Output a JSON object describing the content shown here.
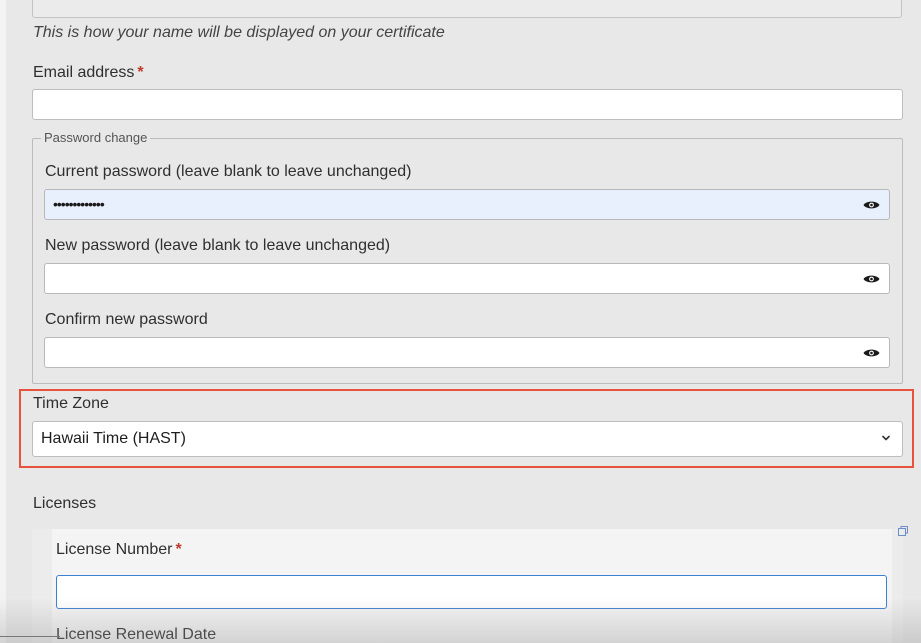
{
  "name_field": {
    "hint": "This is how your name will be displayed on your certificate"
  },
  "email": {
    "label": "Email address",
    "required_marker": "*",
    "value": ""
  },
  "password_change": {
    "legend": "Password change",
    "current": {
      "label": "Current password (leave blank to leave unchanged)",
      "masked_value": "•••••••••••••",
      "icon": "eye-icon"
    },
    "new": {
      "label": "New password (leave blank to leave unchanged)",
      "masked_value": "",
      "icon": "eye-icon"
    },
    "confirm": {
      "label": "Confirm new password",
      "masked_value": "",
      "icon": "eye-icon"
    }
  },
  "time_zone": {
    "label": "Time Zone",
    "selected": "Hawaii Time (HAST)",
    "highlight_color": "#e8533e"
  },
  "licenses": {
    "heading": "Licenses",
    "license_number_label": "License Number",
    "required_marker": "*",
    "license_renewal_label": "License Renewal Date",
    "focus_color": "#3f7fd2"
  }
}
